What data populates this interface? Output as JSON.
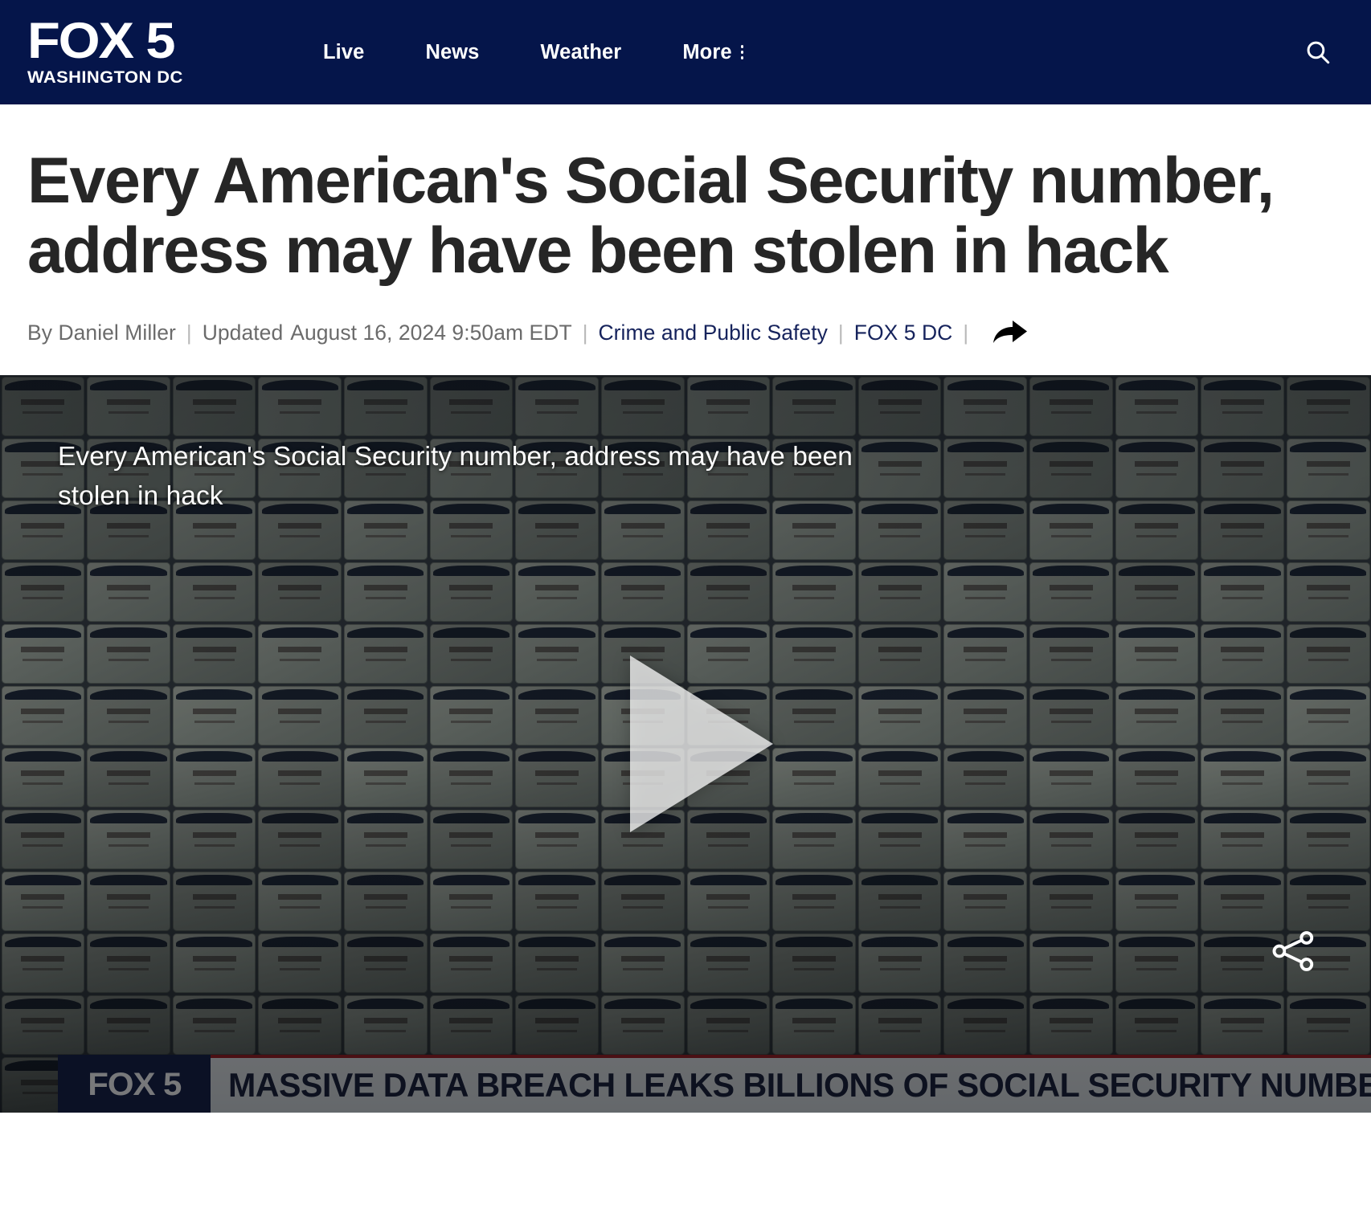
{
  "header": {
    "brand": {
      "name": "FOX 5",
      "market": "WASHINGTON DC"
    },
    "nav": [
      {
        "label": "Live"
      },
      {
        "label": "News"
      },
      {
        "label": "Weather"
      },
      {
        "label": "More"
      }
    ],
    "search_icon": "search-icon",
    "more_icon": "kebab-vertical-icon",
    "background_color": "#05154a"
  },
  "article": {
    "headline": "Every American's Social Security number, address may have been stolen in hack",
    "byline": {
      "author": "By Daniel Miller",
      "updated_label": "Updated",
      "updated_date": "August 16, 2024 9:50am EDT",
      "category": "Crime and Public Safety",
      "source": "FOX 5 DC",
      "separator": "|",
      "share_icon": "share-arrow-icon",
      "link_color": "#16235c"
    }
  },
  "player": {
    "video_title": "Every American's Social Security number, address may have been stolen in hack",
    "play_icon": "play-triangle-icon",
    "share_icon": "share-nodes-icon",
    "chyron": {
      "logo": "FOX 5",
      "text": "MASSIVE DATA BREACH LEAKS BILLIONS OF SOCIAL SECURITY NUMBERS",
      "accent_color": "#7e1317"
    }
  }
}
